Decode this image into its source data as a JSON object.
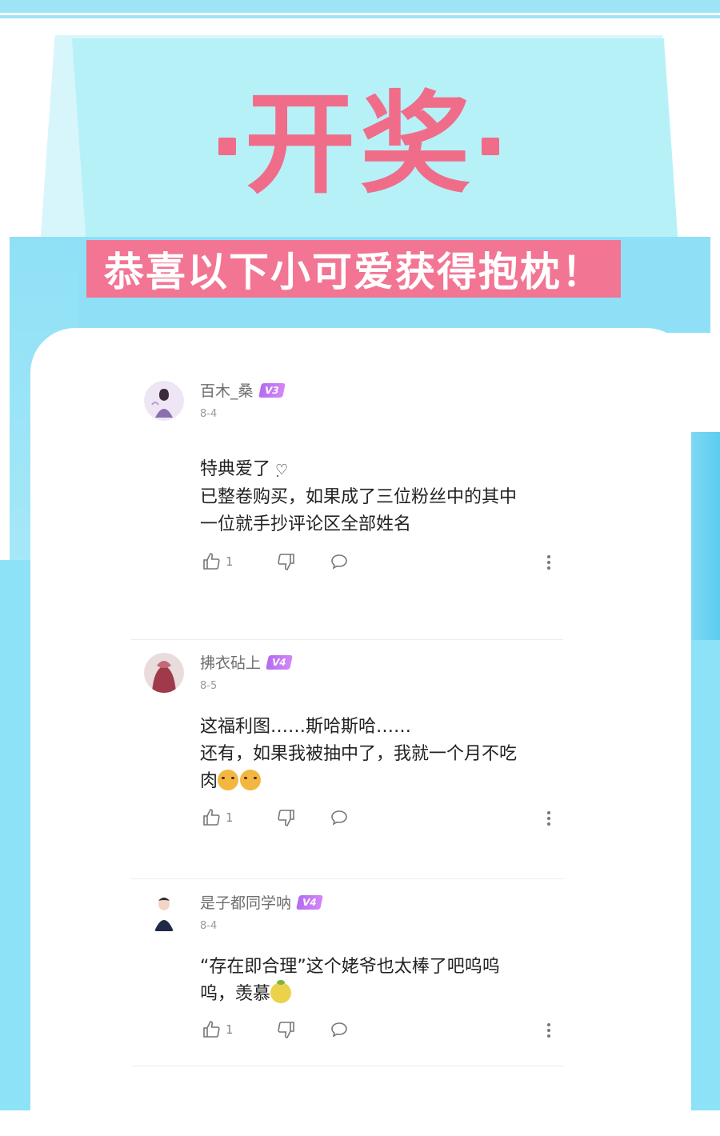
{
  "header": {
    "title": "开奖",
    "banner": "恭喜以下小可爱获得抱枕！"
  },
  "comments": [
    {
      "username": "百木_桑",
      "level": "V3",
      "date": "8-4",
      "lines": [
        "特典爱了",
        "已整卷购买，如果成了三位粉丝中的其中",
        "一位就手抄评论区全部姓名"
      ],
      "likes": "1"
    },
    {
      "username": "拂衣砧上",
      "level": "V4",
      "date": "8-5",
      "lines": [
        "这福利图……斯哈斯哈……",
        "还有，如果我被抽中了，我就一个月不吃",
        "肉"
      ],
      "likes": "1"
    },
    {
      "username": "是子都同学呐",
      "level": "V4",
      "date": "8-4",
      "lines": [
        "“存在即合理”这个姥爷也太棒了吧呜呜",
        "呜，羡慕"
      ],
      "likes": "1"
    }
  ],
  "icons": {
    "like": "thumbs-up-icon",
    "dislike": "thumbs-down-icon",
    "reply": "speech-bubble-icon",
    "more": "vertical-ellipsis-icon"
  },
  "colors": {
    "accent_pink": "#f06d8a",
    "sky_blue": "#8fe0f6",
    "badge_purple": "#b36cf1"
  }
}
